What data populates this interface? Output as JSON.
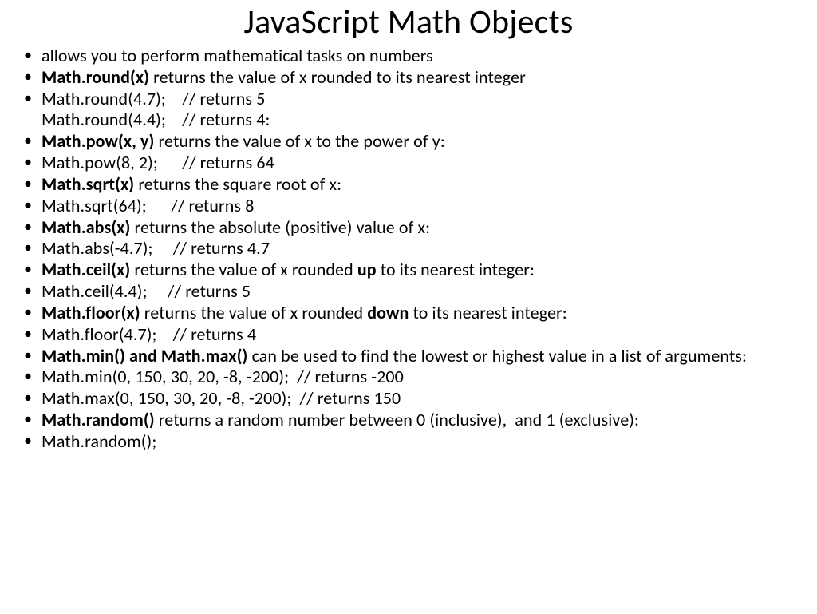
{
  "title": "JavaScript Math Objects",
  "items": {
    "i0": {
      "text": "allows you to perform mathematical tasks on numbers"
    },
    "i1": {
      "bold": "Math.round(x)",
      "text": " returns the value of x rounded to its nearest integer"
    },
    "i2": {
      "line1": "Math.round(4.7);    // returns 5",
      "line2": "Math.round(4.4);    // returns 4:"
    },
    "i3": {
      "bold": "Math.pow(x, y)",
      "text": " returns the value of x to the power of y:"
    },
    "i4": {
      "text": "Math.pow(8, 2);      // returns 64"
    },
    "i5": {
      "bold": "Math.sqrt(x)",
      "text": " returns the square root of x:"
    },
    "i6": {
      "text": "Math.sqrt(64);      // returns 8"
    },
    "i7": {
      "bold": "Math.abs(x)",
      "text": " returns the absolute (positive) value of x:"
    },
    "i8": {
      "text": "Math.abs(-4.7);     // returns 4.7"
    },
    "i9": {
      "bold": "Math.ceil(x)",
      "text1": " returns the value of x rounded ",
      "bold2": "up",
      "text2": " to its nearest integer:"
    },
    "i10": {
      "text": "Math.ceil(4.4);     // returns 5"
    },
    "i11": {
      "bold": "Math.floor(x)",
      "text1": " returns the value of x rounded ",
      "bold2": "down",
      "text2": " to its nearest integer:"
    },
    "i12": {
      "text": "Math.floor(4.7);    // returns 4"
    },
    "i13": {
      "bold": "Math.min() and Math.max()",
      "text": " can be used to find the lowest or highest value in a list of arguments:"
    },
    "i14": {
      "text": "Math.min(0, 150, 30, 20, -8, -200);  // returns -200"
    },
    "i15": {
      "text": "Math.max(0, 150, 30, 20, -8, -200);  // returns 150"
    },
    "i16": {
      "bold": "Math.random()",
      "text": " returns a random number between 0 (inclusive),  and 1 (exclusive):"
    },
    "i17": {
      "text": "Math.random();"
    }
  }
}
